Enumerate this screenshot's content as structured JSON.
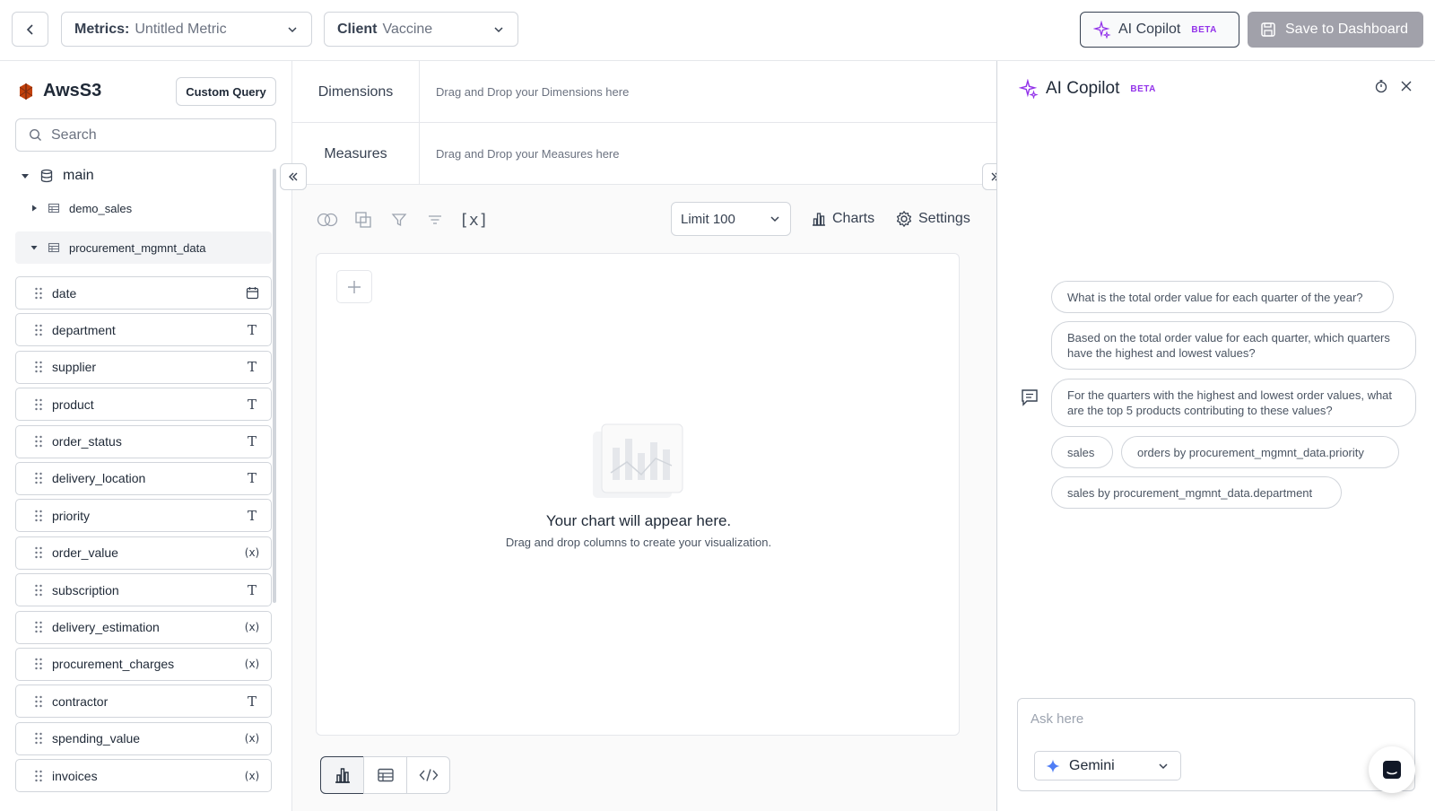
{
  "topbar": {
    "metrics_label": "Metrics:",
    "metrics_value": "Untitled Metric",
    "client_label": "Client",
    "client_value": "Vaccine",
    "copilot_label": "AI Copilot",
    "copilot_badge": "BETA",
    "save_label": "Save to Dashboard"
  },
  "sidebar": {
    "source_name": "AwsS3",
    "custom_query_label": "Custom Query",
    "search_placeholder": "Search",
    "tree": {
      "schema": "main",
      "tables": [
        "demo_sales",
        "procurement_mgmnt_data"
      ]
    },
    "fields": [
      {
        "name": "date",
        "type": "calendar-icon"
      },
      {
        "name": "department",
        "type": "T"
      },
      {
        "name": "supplier",
        "type": "T"
      },
      {
        "name": "product",
        "type": "T"
      },
      {
        "name": "order_status",
        "type": "T"
      },
      {
        "name": "delivery_location",
        "type": "T"
      },
      {
        "name": "priority",
        "type": "T"
      },
      {
        "name": "order_value",
        "type": "(x)"
      },
      {
        "name": "subscription",
        "type": "T"
      },
      {
        "name": "delivery_estimation",
        "type": "(x)"
      },
      {
        "name": "procurement_charges",
        "type": "(x)"
      },
      {
        "name": "contractor",
        "type": "T"
      },
      {
        "name": "spending_value",
        "type": "(x)"
      },
      {
        "name": "invoices",
        "type": "(x)"
      }
    ]
  },
  "builder": {
    "dimensions_label": "Dimensions",
    "dimensions_hint": "Drag and Drop your Dimensions here",
    "measures_label": "Measures",
    "measures_hint": "Drag and Drop your Measures here",
    "variables_icon_text": "[x]",
    "limit_label": "Limit 100",
    "charts_label": "Charts",
    "settings_label": "Settings",
    "empty_title": "Your chart will appear here.",
    "empty_subtitle": "Drag and drop columns to create your visualization."
  },
  "copilot": {
    "title": "AI Copilot",
    "badge": "BETA",
    "suggestions": [
      "What is the total order value for each quarter of the year?",
      "Based on the total order value for each quarter, which quarters have the highest and lowest values?",
      "For the quarters with the highest and lowest order values, what are the top 5 products contributing to these values?",
      "sales",
      "orders by procurement_mgmnt_data.priority",
      "sales by procurement_mgmnt_data.department"
    ],
    "ask_placeholder": "Ask here",
    "model": "Gemini"
  },
  "colors": {
    "accent_purple": "#9333ea",
    "brand_red": "#c2410c",
    "gemini_blue": "#4f7df5"
  }
}
